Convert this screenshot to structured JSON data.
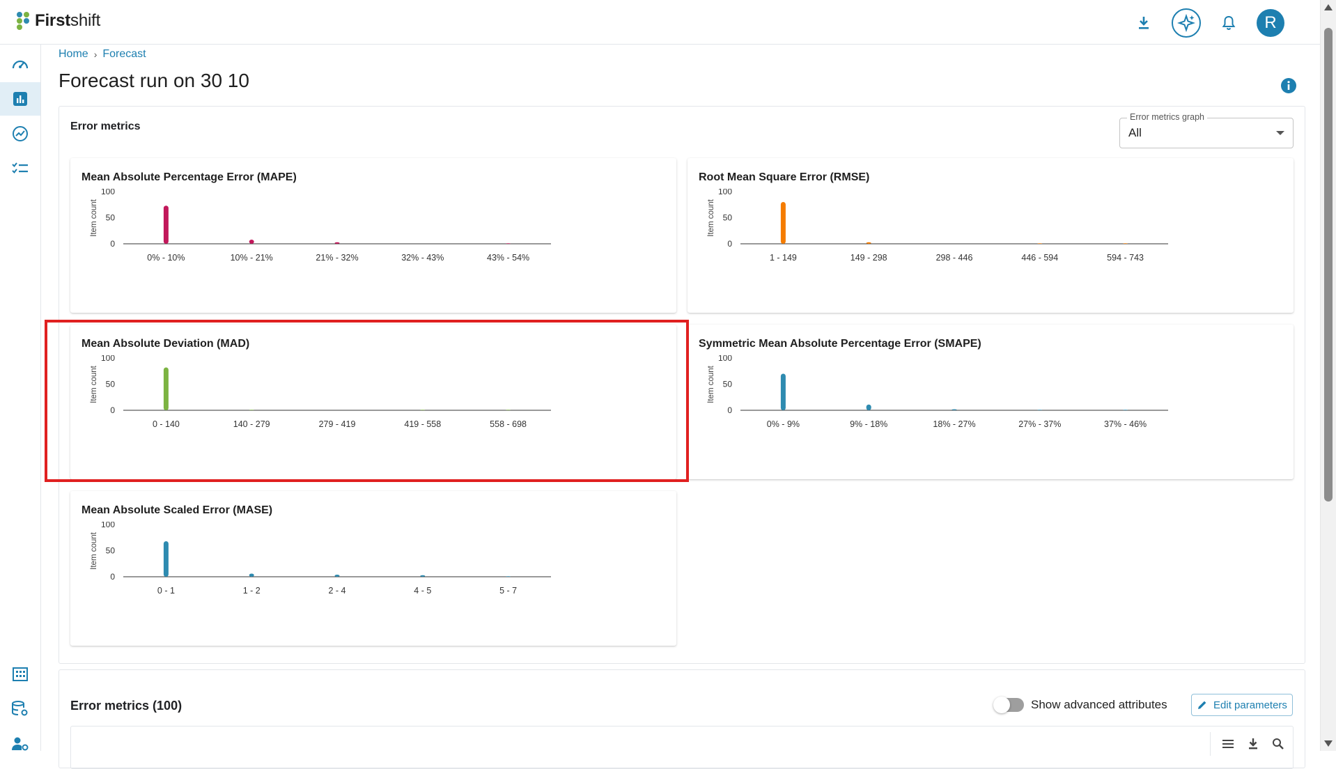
{
  "app": {
    "brand_bold": "First",
    "brand_light": "shift"
  },
  "breadcrumb": [
    "Home",
    "Forecast"
  ],
  "page_title": "Forecast run on 30 10",
  "panel": {
    "title": "Error metrics",
    "select_label": "Error metrics graph",
    "select_value": "All"
  },
  "charts": [
    {
      "title": "Mean Absolute Percentage Error (MAPE)"
    },
    {
      "title": "Root Mean Square Error (RMSE)"
    },
    {
      "title": "Mean Absolute Deviation (MAD)"
    },
    {
      "title": "Symmetric Mean Absolute Percentage Error (SMAPE)"
    },
    {
      "title": "Mean Absolute Scaled Error (MASE)"
    }
  ],
  "chart_data": [
    {
      "type": "bar",
      "title": "Mean Absolute Percentage Error (MAPE)",
      "ylabel": "Item count",
      "ylim": [
        0,
        100
      ],
      "yticks": [
        "100",
        "50",
        "0"
      ],
      "categories": [
        "0% - 10%",
        "10% - 21%",
        "21% - 32%",
        "32% - 43%",
        "43% - 54%"
      ],
      "values": [
        73,
        8,
        3,
        0,
        1
      ],
      "color": "#c2185b"
    },
    {
      "type": "bar",
      "title": "Root Mean Square Error (RMSE)",
      "ylabel": "Item count",
      "ylim": [
        0,
        100
      ],
      "yticks": [
        "100",
        "50",
        "0"
      ],
      "categories": [
        "1 - 149",
        "149 - 298",
        "298 - 446",
        "446 - 594",
        "594 - 743"
      ],
      "values": [
        80,
        3,
        0,
        1,
        1
      ],
      "color": "#f57c00"
    },
    {
      "type": "bar",
      "title": "Mean Absolute Deviation (MAD)",
      "ylabel": "Item count",
      "ylim": [
        0,
        100
      ],
      "yticks": [
        "100",
        "50",
        "0"
      ],
      "categories": [
        "0 - 140",
        "140 - 279",
        "279 - 419",
        "419 - 558",
        "558 - 698"
      ],
      "values": [
        82,
        1,
        0,
        1,
        1
      ],
      "color": "#7cb342"
    },
    {
      "type": "bar",
      "title": "Symmetric Mean Absolute Percentage Error (SMAPE)",
      "ylabel": "Item count",
      "ylim": [
        0,
        100
      ],
      "yticks": [
        "100",
        "50",
        "0"
      ],
      "categories": [
        "0% - 9%",
        "9% - 18%",
        "18% - 27%",
        "27% - 37%",
        "37% - 46%"
      ],
      "values": [
        70,
        11,
        2,
        1,
        1
      ],
      "color": "#2e8bb0"
    },
    {
      "type": "bar",
      "title": "Mean Absolute Scaled Error (MASE)",
      "ylabel": "Item count",
      "ylim": [
        0,
        100
      ],
      "yticks": [
        "100",
        "50",
        "0"
      ],
      "categories": [
        "0 - 1",
        "1 - 2",
        "2 - 4",
        "4 - 5",
        "5 - 7"
      ],
      "values": [
        68,
        6,
        4,
        3,
        1
      ],
      "color": "#2e8bb0"
    }
  ],
  "table_panel": {
    "title": "Error metrics (100)",
    "toggle_label": "Show advanced attributes",
    "toggle_on": false,
    "edit_button": "Edit parameters"
  },
  "colors": {
    "accent": "#1d7fb0",
    "highlight": "#e02020"
  },
  "icons": {
    "top": [
      "download-icon",
      "ai-sparkle-icon",
      "bell-icon"
    ],
    "sidebar": [
      "dashboard-gauge-icon",
      "bar-chart-icon",
      "trend-icon",
      "checklist-icon",
      "building-icon",
      "database-settings-icon",
      "user-settings-icon"
    ],
    "table_tools": [
      "columns-icon",
      "download-icon",
      "search-icon"
    ]
  },
  "user": {
    "initial": "R"
  }
}
